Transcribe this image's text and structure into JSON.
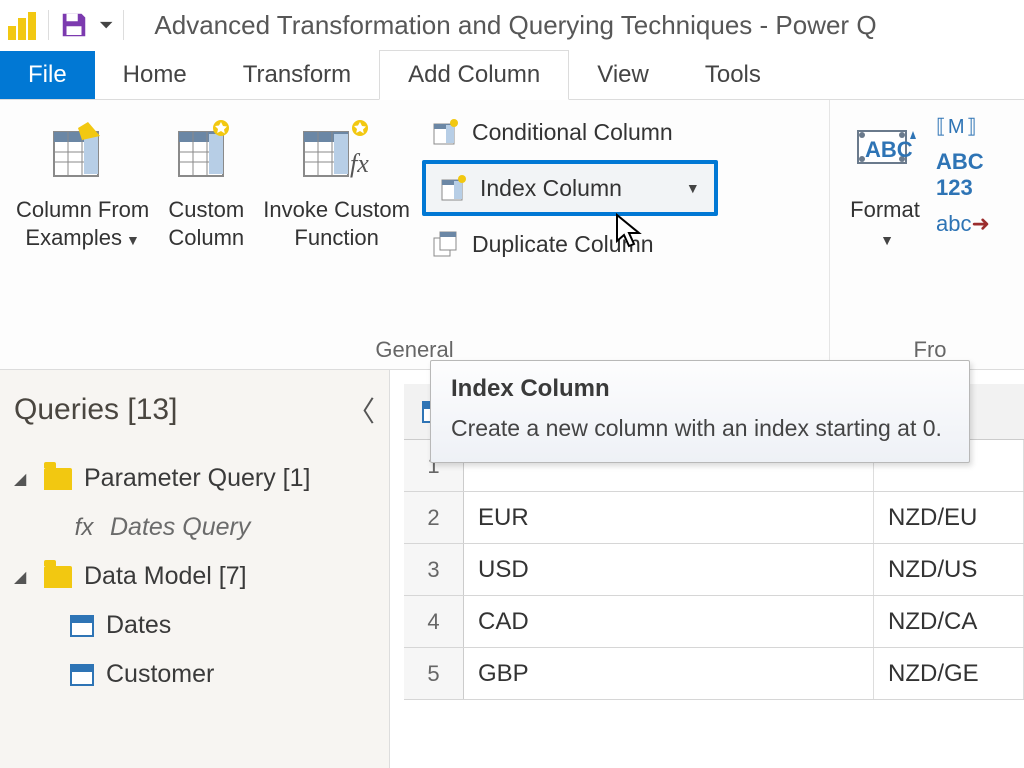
{
  "title": "Advanced Transformation and Querying Techniques - Power Q",
  "tabs": {
    "file": "File",
    "home": "Home",
    "transform": "Transform",
    "addcol": "Add Column",
    "view": "View",
    "tools": "Tools"
  },
  "ribbon": {
    "group_general_label": "General",
    "col_from_examples": "Column From\nExamples",
    "custom_column": "Custom\nColumn",
    "invoke_custom": "Invoke Custom\nFunction",
    "conditional_column": "Conditional Column",
    "index_column": "Index Column",
    "duplicate_column": "Duplicate Column",
    "format": "Format",
    "group_fromtext_label": "Fro",
    "abc123": "ABC\n123",
    "abc_arrow": "abc"
  },
  "tooltip": {
    "title": "Index Column",
    "body": "Create a new column with an index starting at 0."
  },
  "queries": {
    "header": "Queries [13]",
    "group1": "Parameter Query [1]",
    "item1": "Dates Query",
    "group2": "Data Model [7]",
    "item2": "Dates",
    "item3": "Customer"
  },
  "grid": {
    "rows": [
      {
        "n": "1",
        "c1": "",
        "c2": ""
      },
      {
        "n": "2",
        "c1": "EUR",
        "c2": "NZD/EU"
      },
      {
        "n": "3",
        "c1": "USD",
        "c2": "NZD/US"
      },
      {
        "n": "4",
        "c1": "CAD",
        "c2": "NZD/CA"
      },
      {
        "n": "5",
        "c1": "GBP",
        "c2": "NZD/GE"
      }
    ]
  }
}
